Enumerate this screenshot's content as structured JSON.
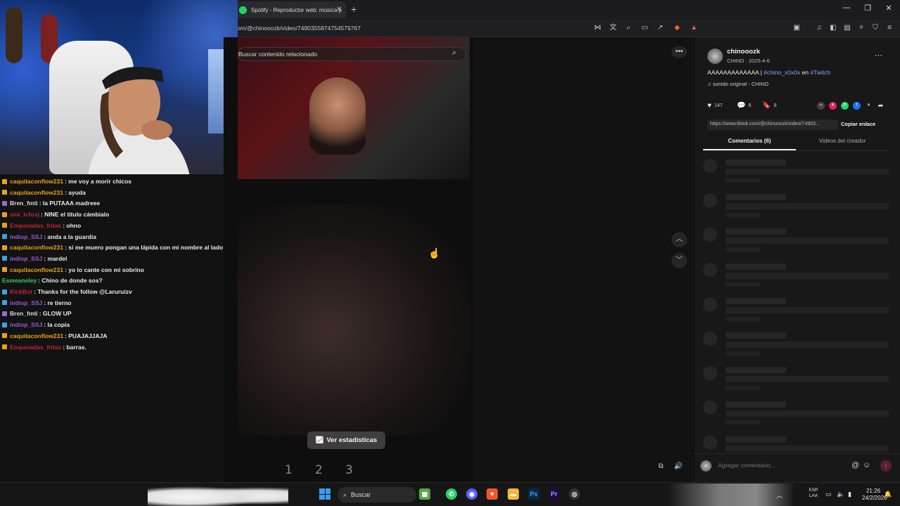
{
  "browser": {
    "tab_title": "Spotify - Reproductor web: música p",
    "url": "om/@chinooozk/video/7490355874754579767"
  },
  "chat": {
    "lines": [
      {
        "user": "caquitaconflow231",
        "sep": ": ",
        "msg": "me voy a morir chicos",
        "color": "#e8a21a",
        "badge": "#e8a21a"
      },
      {
        "user": "caquitaconflow231",
        "sep": ": ",
        "msg": "ayuda",
        "color": "#e8a21a",
        "badge": "#e8a21a"
      },
      {
        "user": "Bren_fmti",
        "sep": ": ",
        "msg": "la PUTAAA madreee",
        "color": "#d9d9d9",
        "badge": "#8b6fd6"
      },
      {
        "user": "mia_tcfosj",
        "sep": ": ",
        "msg": "NINE el título cámbialo",
        "color": "#c0243a",
        "badge": "#e8a21a"
      },
      {
        "user": "Empanadas_fritas",
        "sep": ": ",
        "msg": "ohno",
        "color": "#c0243a",
        "badge": "#e8a21a"
      },
      {
        "user": "indiop_SSJ",
        "sep": " : ",
        "msg": "anda a la guardia",
        "color": "#9b59d0",
        "badge": "#3aa3e3"
      },
      {
        "user": "caquitaconflow231",
        "sep": ": ",
        "msg": "si me muero pongan una lápida con mi nombre al lado del chat",
        "color": "#e8a21a",
        "badge": "#e8a21a"
      },
      {
        "user": "indiop_SSJ",
        "sep": " : ",
        "msg": "mardel",
        "color": "#9b59d0",
        "badge": "#3aa3e3"
      },
      {
        "user": "caquitaconflow231",
        "sep": ": ",
        "msg": "yo lo cante con mi sobrino",
        "color": "#e8a21a",
        "badge": "#e8a21a"
      },
      {
        "user": "Esmeaneley",
        "sep": ": ",
        "msg": "Chino de donde sos?",
        "color": "#3ccf5a",
        "badge": ""
      },
      {
        "user": "KickBot",
        "sep": ": ",
        "msg": "Thanks for the follow @Laruruizv",
        "color": "#c0243a",
        "badge": "#3aa3e3"
      },
      {
        "user": "indiop_SSJ",
        "sep": " : ",
        "msg": "re tierno",
        "color": "#9b59d0",
        "badge": "#3aa3e3"
      },
      {
        "user": "Bren_fmti",
        "sep": ": ",
        "msg": "GLOW UP",
        "color": "#d9d9d9",
        "badge": "#8b6fd6"
      },
      {
        "user": "indiop_SSJ",
        "sep": " : ",
        "msg": "la copia",
        "color": "#9b59d0",
        "badge": "#3aa3e3"
      },
      {
        "user": "caquitaconflow231",
        "sep": ": ",
        "msg": "PUAJAJJAJA",
        "color": "#e8a21a",
        "badge": "#e8a21a"
      },
      {
        "user": "Empanadas_fritas",
        "sep": ": ",
        "msg": "barras.",
        "color": "#c0243a",
        "badge": "#e8a21a"
      }
    ]
  },
  "video": {
    "search_placeholder": "Buscar contenido relacionado",
    "stats_label": "Ver estadísticas",
    "pages": [
      "1",
      "2",
      "3"
    ]
  },
  "post": {
    "username": "chinooozk",
    "subline": "CHINO · 2025-4-6",
    "caption_text": "AAAAAAAAAAAAA | ",
    "caption_tag1": "#chino_x0x0x",
    "caption_mid": " en ",
    "caption_tag2": "#Twitch",
    "sound": "sonido original - CHINO",
    "likes": "147",
    "comments": "6",
    "saves": "8",
    "link": "https://www.tiktok.com/@chinooozk/video/74903...",
    "copy_label": "Copiar enlace",
    "tab_comments": "Comentarios (6)",
    "tab_videos": "Videos del creador",
    "comment_placeholder": "Agregar comentario..."
  },
  "taskbar": {
    "search_label": "Buscar",
    "time": "21:26",
    "date": "24/2/2026",
    "lang1": "ESP",
    "lang2": "LAA"
  },
  "colors": {
    "accent_link": "#7aa6ff",
    "spotify_green": "#1ed760"
  }
}
